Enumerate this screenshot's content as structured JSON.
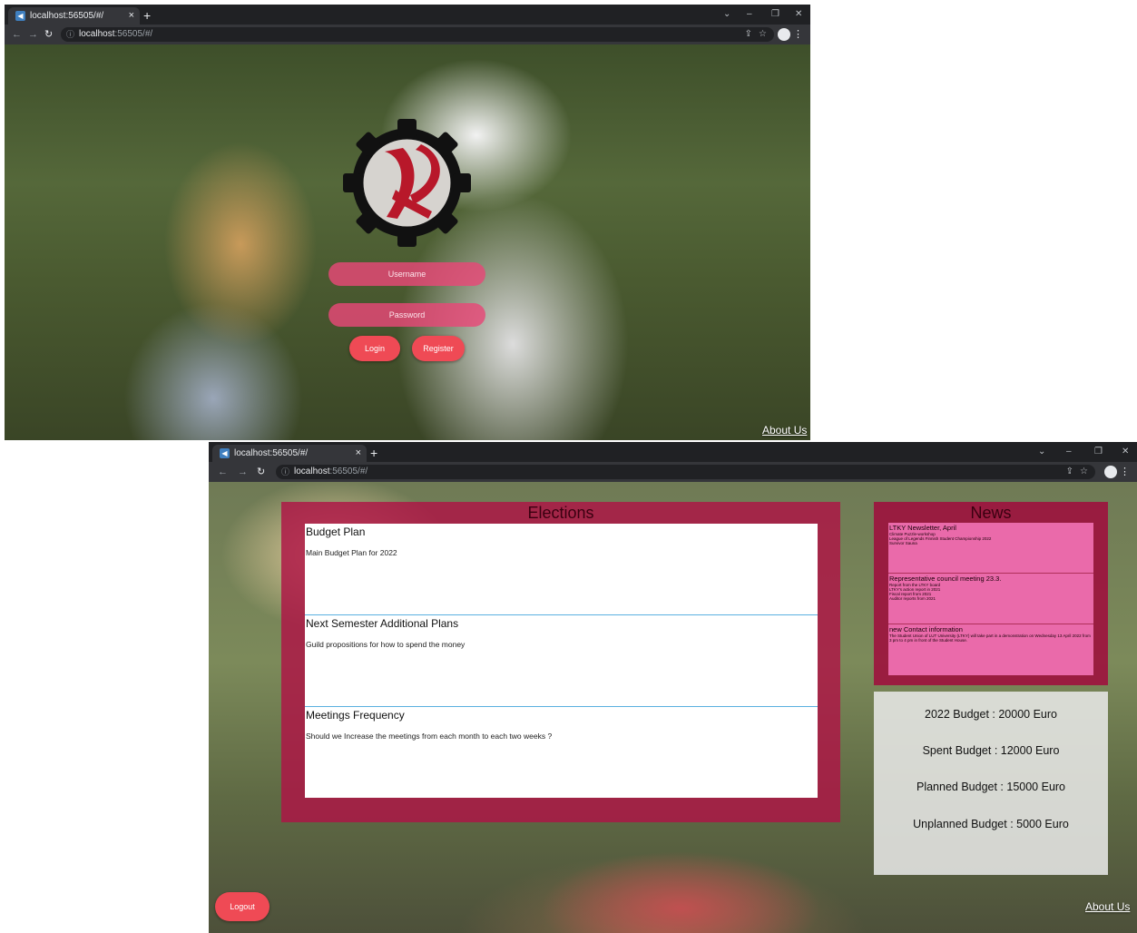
{
  "window1": {
    "tab_title": "localhost:56505/#/",
    "tab_close": "×",
    "new_tab": "+",
    "url_host": "localhost",
    "url_port": ":56505/#/",
    "login": {
      "username_placeholder": "Username",
      "password_placeholder": "Password",
      "login_label": "Login",
      "register_label": "Register"
    },
    "about_label": "About Us"
  },
  "window2": {
    "tab_title": "localhost:56505/#/",
    "tab_close": "×",
    "new_tab": "+",
    "url_host": "localhost",
    "url_port": ":56505/#/",
    "elections": {
      "title": "Elections",
      "items": [
        {
          "title": "Budget Plan",
          "desc": "Main Budget Plan for 2022"
        },
        {
          "title": "Next Semester Additional Plans",
          "desc": "Guild propositions for how to spend the money"
        },
        {
          "title": "Meetings Frequency",
          "desc": "Should we Increase the meetings from each month to each two weeks ?"
        }
      ]
    },
    "news": {
      "title": "News",
      "items": [
        {
          "title": "LTKY Newsletter, April",
          "lines": [
            "Climate Puzzle-workshop",
            "League of Legends Finnish Student Championship 2022",
            "Survivor Sauna"
          ]
        },
        {
          "title": "Representative council meeting 23.3.",
          "lines": [
            "Report from the LTKY board",
            "LTKY's action report in 2021",
            "Fiscal report from 2021",
            "Auditor reports from 2021"
          ]
        },
        {
          "title": "new Contact information",
          "lines": [
            "The Student Union of LUT University (LTKY) will take part in a demonstration on Wednesday 13 April 2022 from 3 pm to 4 pm in front of the Student House."
          ]
        }
      ]
    },
    "budget": {
      "total": "2022 Budget : 20000 Euro",
      "spent": "Spent Budget : 12000 Euro",
      "planned": "Planned Budget : 15000 Euro",
      "unplanned": "Unplanned Budget : 5000 Euro"
    },
    "logout_label": "Logout",
    "about_label": "About Us"
  }
}
